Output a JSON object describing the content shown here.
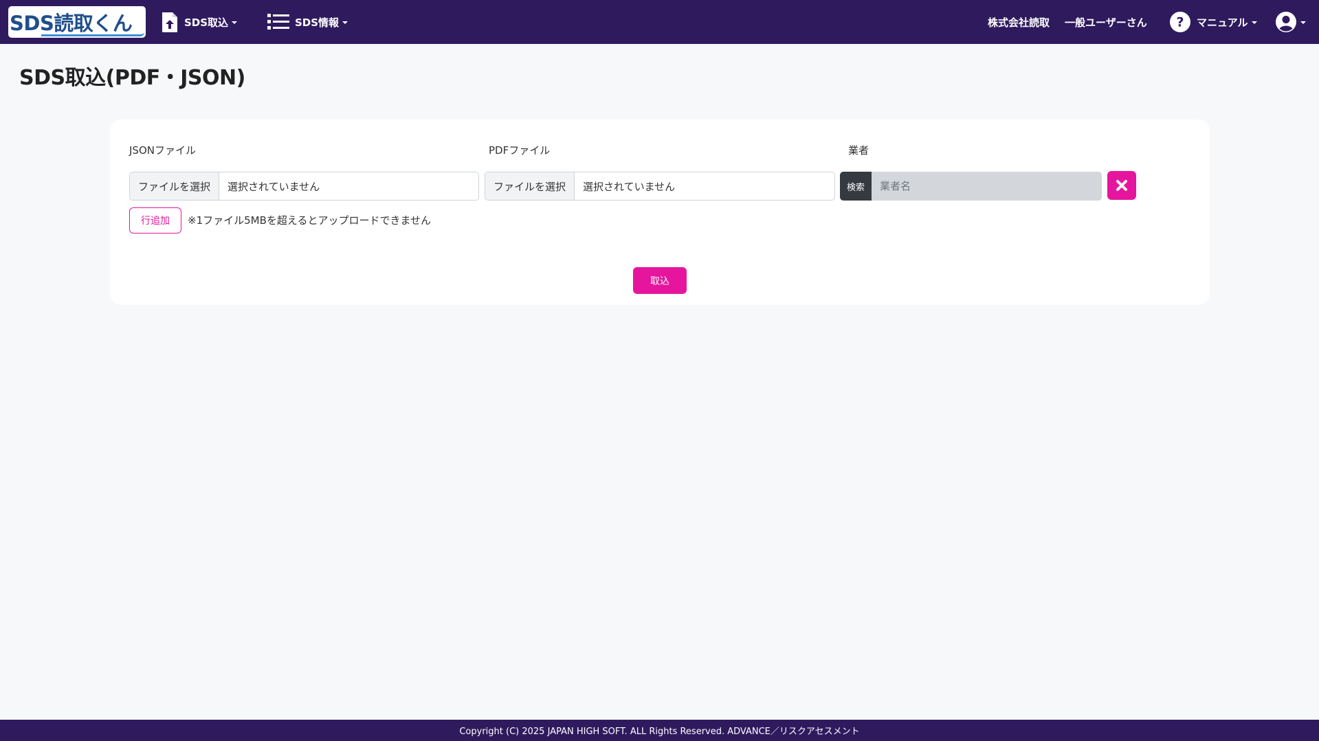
{
  "navbar": {
    "brand": "SDS読取くん",
    "menu": [
      {
        "label": "SDS取込",
        "icon": "file-upload-icon"
      },
      {
        "label": "SDS情報",
        "icon": "list-icon"
      }
    ],
    "company": "株式会社読取",
    "user": "一般ユーザーさん",
    "manual_label": "マニュアル",
    "manual_icon": "question-circle-icon",
    "user_icon": "user-circle-icon"
  },
  "page": {
    "title": "SDS取込(PDF・JSON)"
  },
  "form": {
    "json_label": "JSONファイル",
    "pdf_label": "PDFファイル",
    "vendor_label": "業者",
    "choose_file_label": "ファイルを選択",
    "no_file_text": "選択されていません",
    "vendor_search_label": "検索",
    "vendor_placeholder": "業者名",
    "add_row_label": "行追加",
    "note": "※1ファイル5MBを超えるとアップロードできません",
    "import_label": "取込"
  },
  "footer": {
    "copyright": "Copyright (C) 2025 JAPAN HIGH SOFT. ALL Rights Reserved. ADVANCE／リスクアセスメント"
  },
  "colors": {
    "navbar": "#2f1a5e",
    "accent": "#e5169d",
    "background": "#f7f8fa"
  }
}
